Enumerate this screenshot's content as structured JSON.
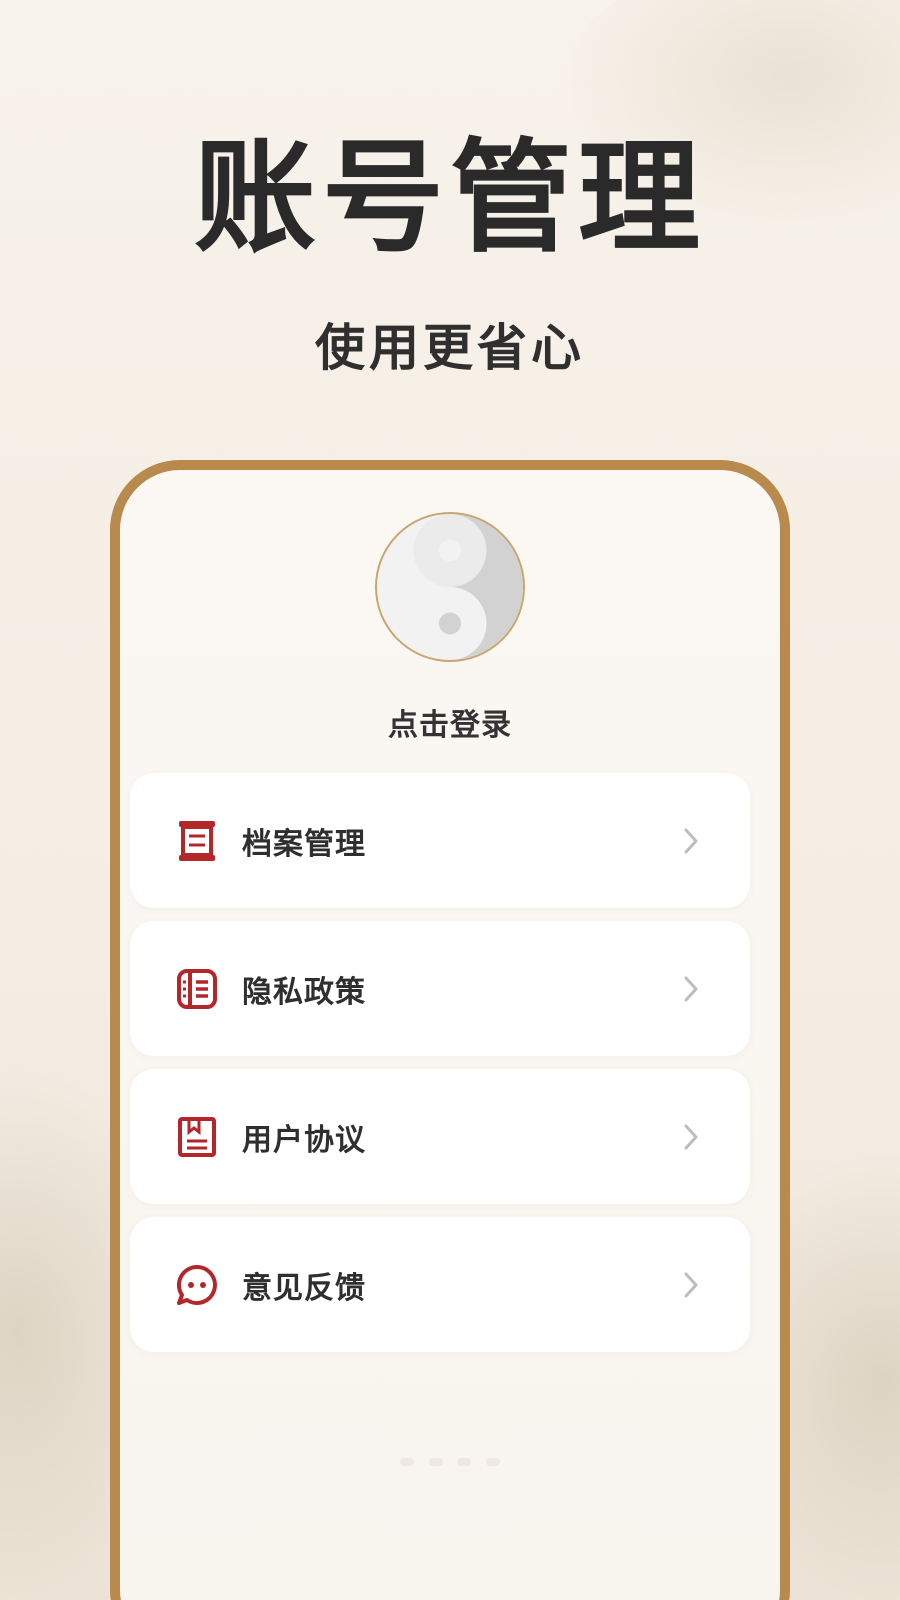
{
  "hero": {
    "title": "账号管理",
    "subtitle": "使用更省心"
  },
  "profile": {
    "avatar_icon": "yin-yang-icon",
    "login_label": "点击登录"
  },
  "menu": {
    "items": [
      {
        "label": "档案管理",
        "icon": "scroll-icon"
      },
      {
        "label": "隐私政策",
        "icon": "list-document-icon"
      },
      {
        "label": "用户协议",
        "icon": "agreement-book-icon"
      },
      {
        "label": "意见反馈",
        "icon": "chat-bubble-icon"
      }
    ]
  },
  "colors": {
    "accent": "#b88a4e",
    "icon_red": "#b3262a",
    "chevron": "#bdbdbd",
    "card_bg": "#ffffff"
  }
}
